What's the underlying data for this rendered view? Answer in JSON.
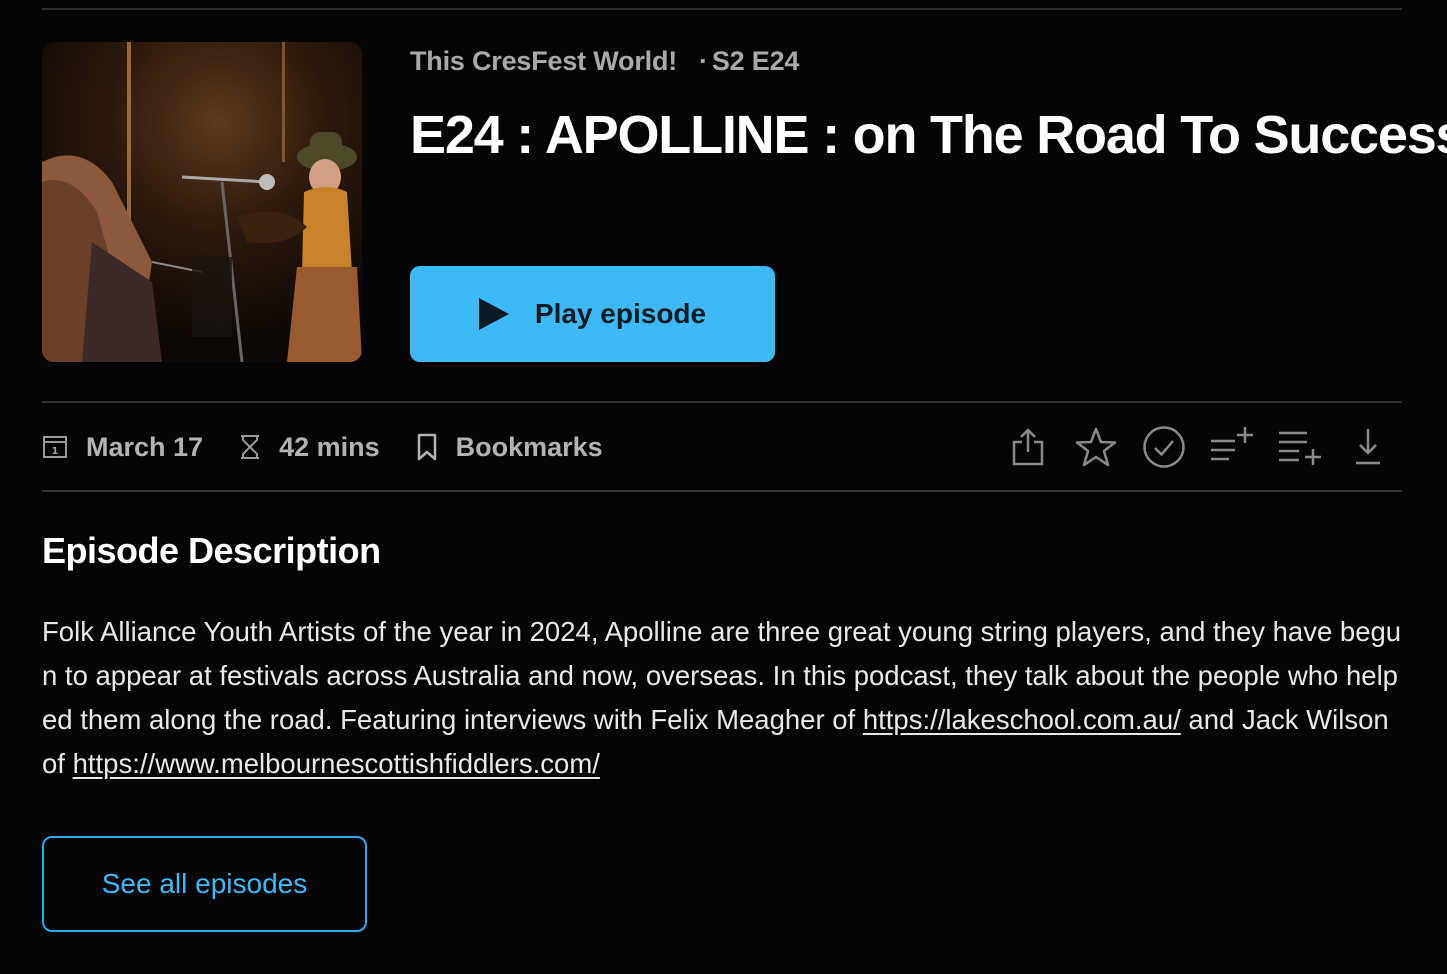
{
  "header": {
    "show_name": "This CresFest World!",
    "separator": "·",
    "season_episode": "S2 E24",
    "title": "E24 : APOLLINE : on The Road To Success"
  },
  "play": {
    "label": "Play episode"
  },
  "meta": {
    "date": "March 17",
    "duration": "42 mins",
    "bookmarks": "Bookmarks"
  },
  "actions": [
    {
      "icon": "share-icon"
    },
    {
      "icon": "star-icon"
    },
    {
      "icon": "check-circle-icon"
    },
    {
      "icon": "play-next-icon"
    },
    {
      "icon": "add-to-queue-icon"
    },
    {
      "icon": "download-icon"
    }
  ],
  "description": {
    "heading": "Episode Description",
    "text_1": "Folk Alliance Youth Artists of the year in 2024, Apolline are three great young string players, and they have begun to appear at festivals across Australia and now, overseas. In this podcast, they talk about the people who helped them along the road. Featuring interviews with Felix Meagher of ",
    "link_1": "https://lakeschool.com.au/",
    "text_2": " and Jack Wilson of ",
    "link_2": "https://www.melbournescottishfiddlers.com/"
  },
  "see_all": {
    "label": "See all episodes"
  },
  "colors": {
    "accent": "#3dbaf5",
    "background": "#050505",
    "muted_text": "#b3b3b3"
  }
}
